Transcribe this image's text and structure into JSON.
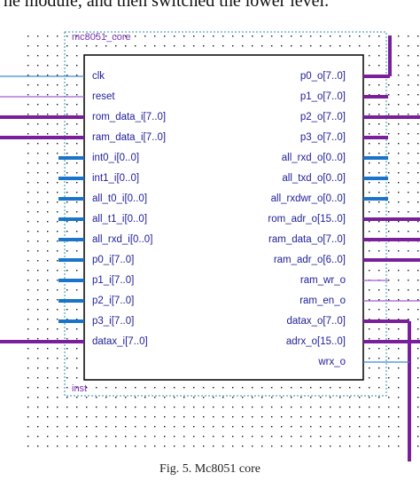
{
  "header_text": "he module, and then switched the lower level.",
  "module": {
    "name": "mc8051_core",
    "instance": "inst",
    "inputs": [
      "clk",
      "reset",
      "rom_data_i[7..0]",
      "ram_data_i[7..0]",
      "int0_i[0..0]",
      "int1_i[0..0]",
      "all_t0_i[0..0]",
      "all_t1_i[0..0]",
      "all_rxd_i[0..0]",
      "p0_i[7..0]",
      "p1_i[7..0]",
      "p2_i[7..0]",
      "p3_i[7..0]",
      "datax_i[7..0]"
    ],
    "outputs": [
      "p0_o[7..0]",
      "p1_o[7..0]",
      "p2_o[7..0]",
      "p3_o[7..0]",
      "all_rxd_o[0..0]",
      "all_txd_o[0..0]",
      "all_rxdwr_o[0..0]",
      "rom_adr_o[15..0]",
      "ram_data_o[7..0]",
      "ram_adr_o[6..0]",
      "ram_wr_o",
      "ram_en_o",
      "datax_o[7..0]",
      "adrx_o[15..0]",
      "wrx_o"
    ]
  },
  "caption": "Fig. 5.   Mc8051 core",
  "colors": {
    "bus_purple": "#7a1f9c",
    "bus_blue": "#1a74c9",
    "wire_purple": "#a35bd1",
    "wire_blue": "#3a8ad8",
    "dots": "#111111",
    "box_outline": "#2e8fa6"
  }
}
